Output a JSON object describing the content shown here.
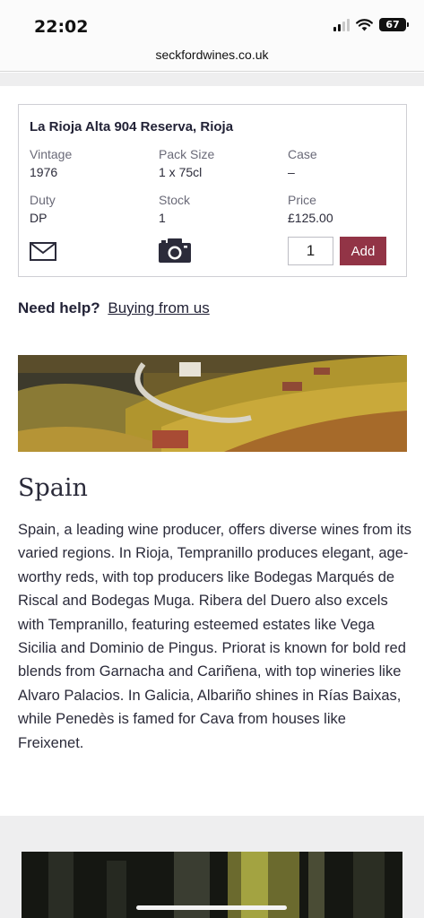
{
  "status_bar": {
    "time": "22:02",
    "battery": "67"
  },
  "browser": {
    "url": "seckfordwines.co.uk"
  },
  "product": {
    "title": "La Rioja Alta 904 Reserva, Rioja",
    "vintage_label": "Vintage",
    "vintage": "1976",
    "pack_label": "Pack Size",
    "pack": "1 x 75cl",
    "case_label": "Case",
    "case": "–",
    "duty_label": "Duty",
    "duty": "DP",
    "stock_label": "Stock",
    "stock": "1",
    "price_label": "Price",
    "price": "£125.00",
    "quantity": "1",
    "add_label": "Add",
    "icons": [
      "mail-icon",
      "camera-icon"
    ],
    "accent_color": "#923446"
  },
  "help": {
    "label": "Need help?",
    "link": "Buying from us"
  },
  "region": {
    "title": "Spain",
    "description": "Spain, a leading wine producer, offers diverse wines from its varied regions. In Rioja, Tempranillo produces elegant, age-worthy reds, with top producers like Bodegas Marqués de Riscal and Bodegas Muga. Ribera del Duero also excels with Tempranillo, featuring esteemed estates like Vega Sicilia and Dominio de Pingus. Priorat is known for bold red blends from Garnacha and Cariñena, with top wineries like Alvaro Palacios. In Galicia, Albariño shines in Rías Baixas, while Penedès is famed for Cava from houses like Freixenet."
  }
}
